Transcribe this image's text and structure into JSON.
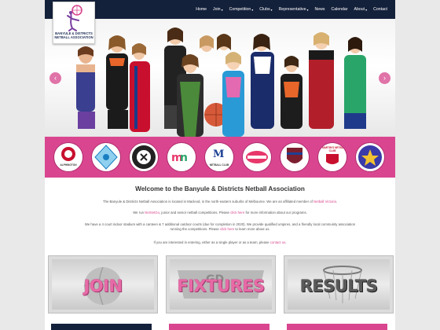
{
  "logo": {
    "line1": "BANYULE & DISTRICTS",
    "line2": "NETBALL ASSOCIATION"
  },
  "nav": [
    {
      "label": "Home",
      "dropdown": false
    },
    {
      "label": "Join",
      "dropdown": true
    },
    {
      "label": "Competition",
      "dropdown": true
    },
    {
      "label": "Clubs",
      "dropdown": true
    },
    {
      "label": "Representative",
      "dropdown": true
    },
    {
      "label": "News",
      "dropdown": false
    },
    {
      "label": "Calendar",
      "dropdown": false
    },
    {
      "label": "About",
      "dropdown": true
    },
    {
      "label": "Contact",
      "dropdown": false
    }
  ],
  "slider": {
    "prev_icon": "chevron-left-icon",
    "next_icon": "chevron-right-icon"
  },
  "club_badges": [
    {
      "name": "ALPHINGTON",
      "color": "#c8102e"
    },
    {
      "name": "",
      "color": "#1a7fc1"
    },
    {
      "name": "",
      "color": "#222222"
    },
    {
      "name": "",
      "color": "#7a3fa0"
    },
    {
      "name": "NETBALL CLUB",
      "color": "#1c3f94"
    },
    {
      "name": "",
      "color": "#e8386b"
    },
    {
      "name": "",
      "color": "#7b1f2f"
    },
    {
      "name": "ST MARTIN'S NETBALL CLUB",
      "color": "#c8102e"
    },
    {
      "name": "",
      "color": "#3a3aa8"
    }
  ],
  "welcome": {
    "title": "Welcome to the Banyule & Districts Netball Association",
    "p1_a": "The Banyule & Districts Netball Association is located in Macleod, in the north-eastern suburbs of Melbourne. We are an affiliated member of ",
    "p1_link": "Netball Victoria",
    "p1_b": ".",
    "p2_a": "We run ",
    "p2_link1": "NetSetGo",
    "p2_b": ", junior and senior netball competitions. Please ",
    "p2_link2": "click here",
    "p2_c": " for more information about our programs.",
    "p3_a": "We have a 4 court indoor stadium with a canteen & 7 additional outdoor courts (due for completion in 2020). We provide qualified umpires, and a friendly local community association",
    "p3_b": "running the competitions. Please ",
    "p3_link": "click here",
    "p3_c": " to learn more about us.",
    "p4_a": "If you are interested in entering, either as a single player or as a team, please ",
    "p4_link": "contact us",
    "p4_b": "."
  },
  "tiles": [
    {
      "label": "JOIN"
    },
    {
      "label": "FIXTURES"
    },
    {
      "label": "RESULTS"
    }
  ],
  "colors": {
    "navy": "#14213b",
    "pink": "#d9468f"
  }
}
